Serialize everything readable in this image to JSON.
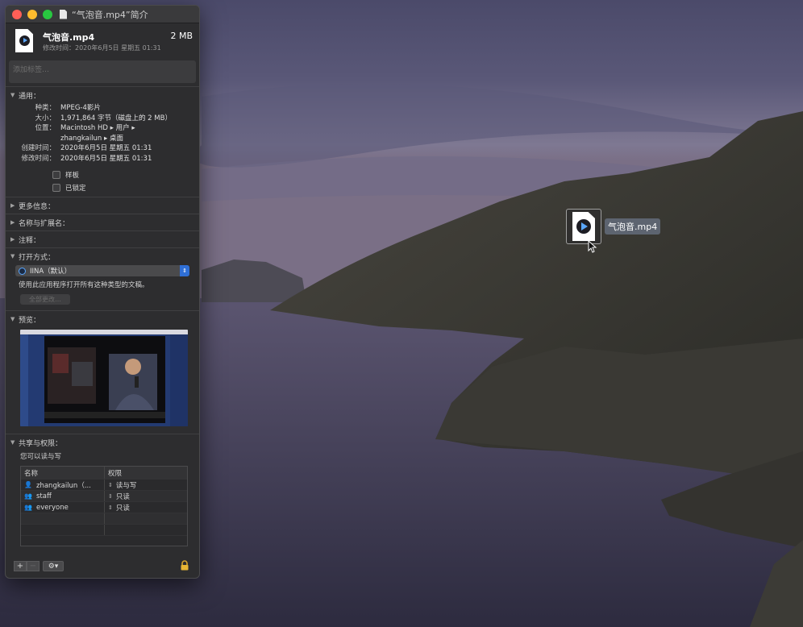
{
  "window": {
    "title": "“气泡音.mp4”简介"
  },
  "header": {
    "file_name": "气泡音.mp4",
    "file_size": "2 MB",
    "modified_line": "修改时间：2020年6月5日 星期五 01:31"
  },
  "tags": {
    "placeholder": "添加标签…"
  },
  "general": {
    "heading": "通用：",
    "rows": [
      {
        "k": "种类：",
        "v": "MPEG-4影片"
      },
      {
        "k": "大小：",
        "v": "1,971,864 字节（磁盘上的 2 MB）"
      },
      {
        "k": "位置：",
        "v": "Macintosh HD ▸ 用户 ▸"
      },
      {
        "k": "",
        "v": "zhangkailun ▸ 桌面"
      },
      {
        "k": "创建时间：",
        "v": "2020年6月5日 星期五 01:31"
      },
      {
        "k": "修改时间：",
        "v": "2020年6月5日 星期五 01:31"
      }
    ],
    "stationery": "样板",
    "locked": "已锁定"
  },
  "more_info": {
    "heading": "更多信息："
  },
  "name_ext": {
    "heading": "名称与扩展名："
  },
  "comments": {
    "heading": "注释："
  },
  "open_with": {
    "heading": "打开方式：",
    "app": "IINA（默认）",
    "hint": "使用此应用程序打开所有这种类型的文稿。",
    "change_all": "全部更改…"
  },
  "preview": {
    "heading": "预览："
  },
  "sharing": {
    "heading": "共享与权限：",
    "note": "您可以读与写",
    "col_name": "名称",
    "col_priv": "权限",
    "rows": [
      {
        "user": "zhangkailun（...",
        "priv": "读与写",
        "icon": "user-icon"
      },
      {
        "user": "staff",
        "priv": "只读",
        "icon": "group-icon"
      },
      {
        "user": "everyone",
        "priv": "只读",
        "icon": "group-icon"
      }
    ]
  },
  "footer": {
    "add": "+",
    "remove": "−",
    "action": "⚙▾"
  },
  "desktop": {
    "file_label": "气泡音.mp4"
  }
}
